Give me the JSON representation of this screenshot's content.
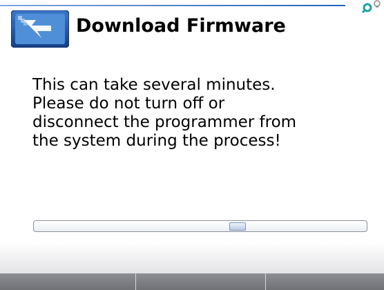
{
  "dialog": {
    "title": "Download Firmware",
    "message": "This can take several minutes.\nPlease do not turn off or\ndisconnect the programmer from\nthe system during the process!"
  },
  "progress": {
    "fraction": 0.62,
    "indeterminate": true
  },
  "softkeys": [
    {
      "label": ""
    },
    {
      "label": ""
    },
    {
      "label": ""
    }
  ],
  "colors": {
    "accent": "#1f63c0",
    "icon_frame": "#245fb0",
    "corner_icon": "#1aa3a3"
  },
  "icons": {
    "app": "download-arrow-icon",
    "corner": "search-icon",
    "corner2": "bulb-icon"
  }
}
